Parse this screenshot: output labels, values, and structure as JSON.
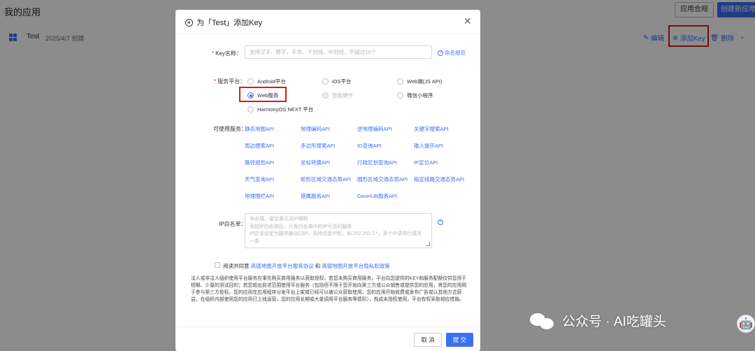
{
  "page": {
    "title": "我的应用"
  },
  "header_buttons": {
    "compliance": "应用合规",
    "create": "创建新应用"
  },
  "app_row": {
    "name": "Test",
    "date": "2025/4/7 创建",
    "edit": "编辑",
    "add_key": "添加Key",
    "delete": "删除"
  },
  "modal": {
    "title": "为「Test」添加Key",
    "key_name": {
      "label": "Key名称：",
      "placeholder": "支持汉字、数字、字母、下划线、中划线，不超过15个",
      "help": "命名规范"
    },
    "platform": {
      "label": "服务平台：",
      "options": [
        {
          "label": "Android平台",
          "state": "unchecked"
        },
        {
          "label": "iOS平台",
          "state": "unchecked"
        },
        {
          "label": "Web端(JS API)",
          "state": "unchecked"
        },
        {
          "label": "Web服务",
          "state": "checked"
        },
        {
          "label": "智能硬件",
          "state": "disabled"
        },
        {
          "label": "微信小程序",
          "state": "unchecked"
        },
        {
          "label": "HarmonyOS NEXT 平台",
          "state": "unchecked"
        }
      ]
    },
    "services": {
      "label": "可使用服务：",
      "items": [
        "静态地图API",
        "地理编码API",
        "逆地理编码API",
        "关键字搜索API",
        "周边搜索API",
        "多边形搜索API",
        "ID查询API",
        "输入提示API",
        "路径规划API",
        "坐标转换API",
        "行政区划查询API",
        "IP定位API",
        "天气查询API",
        "矩形区域交通态势API",
        "圆形区域交通态势API",
        "指定线路交通态势API",
        "地理围栏API",
        "猎鹰服务API",
        "GeoHUB服务API"
      ]
    },
    "ip_whitelist": {
      "label": "IP白名单：",
      "placeholder_lines": [
        "非必填，留空表示无IP限制",
        "添加IP白名单后，只有白名单中的IP可访问服务",
        "IP应该设定为服务器出口IP，支持设定IP段，如:202.202.2.*，多个IP请用行填写",
        "一条"
      ]
    },
    "agreement": {
      "prefix": "阅读并同意",
      "link1": "高德地图开放平台服务协议",
      "and": "和",
      "link2": "高德地图开放平台隐私权政策"
    },
    "notice": "法人或非法人组织使用平台服务应事先购买商用服务以获取授权。若您未购买商用服务，平台向您提供的KEY和服务配额仅供您用于短期、少量的测试目的；若您超出前述范围使用平台服务（包括但不限于您开始向第三方或公众销售或提供您的应用，将您的应用用于参与第三方投标，您的应用在应用程序分发平台上架或已经可以被公众获取使用，您的应用开始收费或发布广告或以其他方式获益，在组织内部使用您的应用已上线运营，您的应用长期或大量调用平台服务等情形），构成未授权使用，平台有权采取相应措施。",
    "cancel": "取 消",
    "submit": "提 交"
  },
  "watermark": {
    "text": "公众号 · AI吃罐头"
  },
  "colors": {
    "primary": "#3a70f2",
    "highlight": "#d71a1a",
    "overlay": "rgba(0,0,0,0.45)"
  }
}
